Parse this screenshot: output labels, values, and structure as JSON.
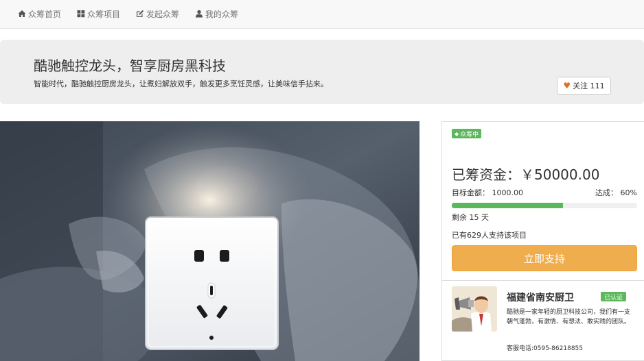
{
  "nav": {
    "items": [
      {
        "label": "众筹首页",
        "icon": "home-icon"
      },
      {
        "label": "众筹项目",
        "icon": "grid-icon"
      },
      {
        "label": "发起众筹",
        "icon": "edit-icon"
      },
      {
        "label": "我的众筹",
        "icon": "user-icon"
      }
    ]
  },
  "hero": {
    "title": "酷驰触控龙头，智享厨房黑科技",
    "subtitle": "智能时代，酷驰触控厨房龙头，让煮妇解放双手，触发更多烹饪灵感，让美味信手拈来。",
    "follow_label": "关注 111",
    "follow_icon": "heart-icon"
  },
  "project": {
    "status_label": "众筹中",
    "raised_text": "已筹资金：￥50000.00",
    "target_text": "目标金额： 1000.00",
    "reach_text": "达成： 60%",
    "progress_percent": 60,
    "remaining_text": "剩余 15 天",
    "supporters_text": "已有629人支持该项目",
    "support_button": "立即支持"
  },
  "company": {
    "name": "福建省南安厨卫",
    "verified_label": "已认证",
    "description": "酷驰是一家年轻的厨卫科技公司，我们有一支朝气蓬勃，有激情、有想法、敢实践的团队。",
    "phone": "客服电话:0595-86218855"
  },
  "colors": {
    "success": "#5cb85c",
    "warning": "#f0ad4e",
    "heart": "#e0701f",
    "nav_bg": "#f8f8f8",
    "hero_bg": "#eeeeee"
  }
}
